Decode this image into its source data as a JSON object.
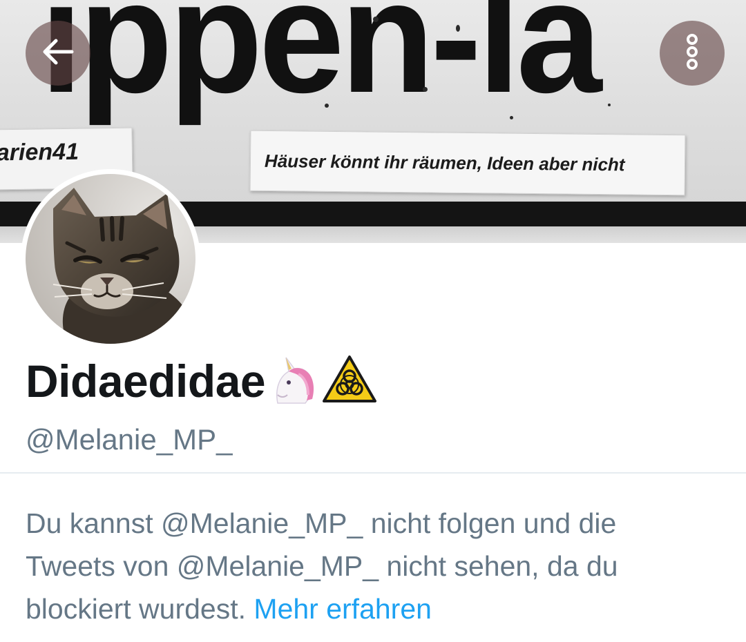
{
  "banner": {
    "big_text": "ippen-la",
    "sticker_left": "arien41",
    "sticker_right": "Häuser könnt ihr räumen, Ideen aber nicht"
  },
  "nav": {
    "back_icon": "arrow-left-icon",
    "more_icon": "more-vertical-icon"
  },
  "profile": {
    "avatar": "cat-avatar",
    "display_name": "Didaedidae",
    "display_name_emojis": [
      "unicorn-emoji",
      "biohazard-warning-emoji"
    ],
    "handle": "@Melanie_MP_"
  },
  "blocked": {
    "line1": "Du kannst @Melanie_MP_ nicht folgen und die",
    "line2": "Tweets von @Melanie_MP_ nicht sehen, da du",
    "line3": "blockiert wurdest.",
    "learn_more": "Mehr erfahren"
  },
  "colors": {
    "text_primary": "#14171a",
    "text_secondary": "#657786",
    "link": "#1da1f2",
    "divider": "#e6ecf0"
  }
}
